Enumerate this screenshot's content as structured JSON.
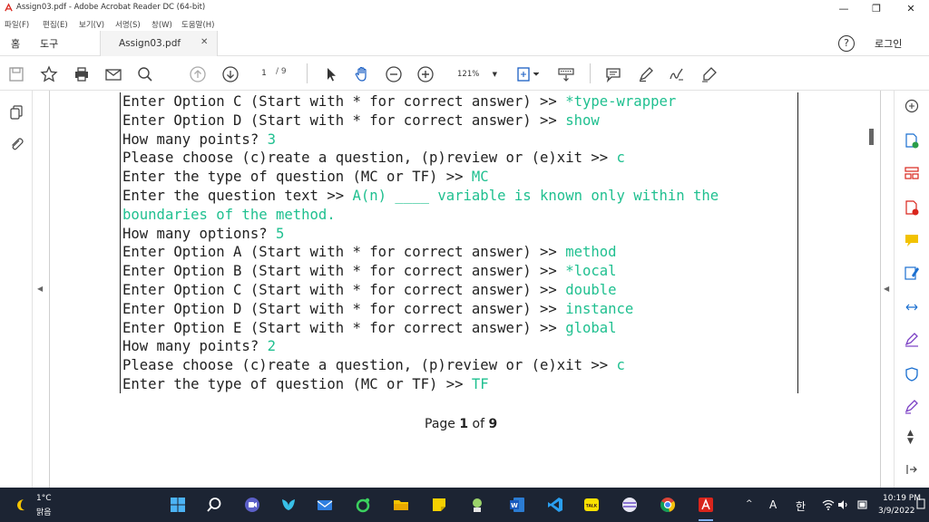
{
  "window": {
    "title": "Assign03.pdf - Adobe Acrobat Reader DC (64-bit)"
  },
  "menu": [
    "파일(F)",
    "편집(E)",
    "보기(V)",
    "서명(S)",
    "창(W)",
    "도움말(H)"
  ],
  "tabs": {
    "home": "홈",
    "tools": "도구",
    "document": "Assign03.pdf",
    "login": "로그인",
    "help": "?"
  },
  "toolbar": {
    "current_page": "1",
    "total_pages": "/ 9",
    "zoom": "121%"
  },
  "document": {
    "lines": [
      {
        "prompt": "Enter Option C (Start with * for correct answer) >> ",
        "answer": "*type-wrapper"
      },
      {
        "prompt": "Enter Option D (Start with * for correct answer) >> ",
        "answer": "show"
      },
      {
        "prompt": "How many points? ",
        "answer": "3"
      },
      {
        "prompt": "Please choose (c)reate a question, (p)review or (e)xit >> ",
        "answer": "c"
      },
      {
        "prompt": "Enter the type of question (MC or TF) >> ",
        "answer": "MC"
      },
      {
        "prompt": "Enter the question text >> ",
        "answer": "A(n) ____ variable is known only within the"
      },
      {
        "prompt": "",
        "answer": "boundaries of the method."
      },
      {
        "prompt": "How many options? ",
        "answer": "5"
      },
      {
        "prompt": "Enter Option A (Start with * for correct answer) >> ",
        "answer": "method"
      },
      {
        "prompt": "Enter Option B (Start with * for correct answer) >> ",
        "answer": "*local"
      },
      {
        "prompt": "Enter Option C (Start with * for correct answer) >> ",
        "answer": "double"
      },
      {
        "prompt": "Enter Option D (Start with * for correct answer) >> ",
        "answer": "instance"
      },
      {
        "prompt": "Enter Option E (Start with * for correct answer) >> ",
        "answer": "global"
      },
      {
        "prompt": "How many points? ",
        "answer": "2"
      },
      {
        "prompt": "Please choose (c)reate a question, (p)review or (e)xit >> ",
        "answer": "c"
      },
      {
        "prompt": "Enter the type of question (MC or TF) >> ",
        "answer": "TF"
      }
    ],
    "page_label_prefix": "Page ",
    "page_label_current": "1",
    "page_label_mid": " of ",
    "page_label_total": "9"
  },
  "taskbar": {
    "temperature": "1°C",
    "weather": "맑음",
    "ime_a": "A",
    "ime_han": "한",
    "time": "10:19 PM",
    "date": "3/9/2022"
  },
  "colors": {
    "answer": "#20c090",
    "taskbar": "#1c2433",
    "acrobat_red": "#d9251c"
  }
}
